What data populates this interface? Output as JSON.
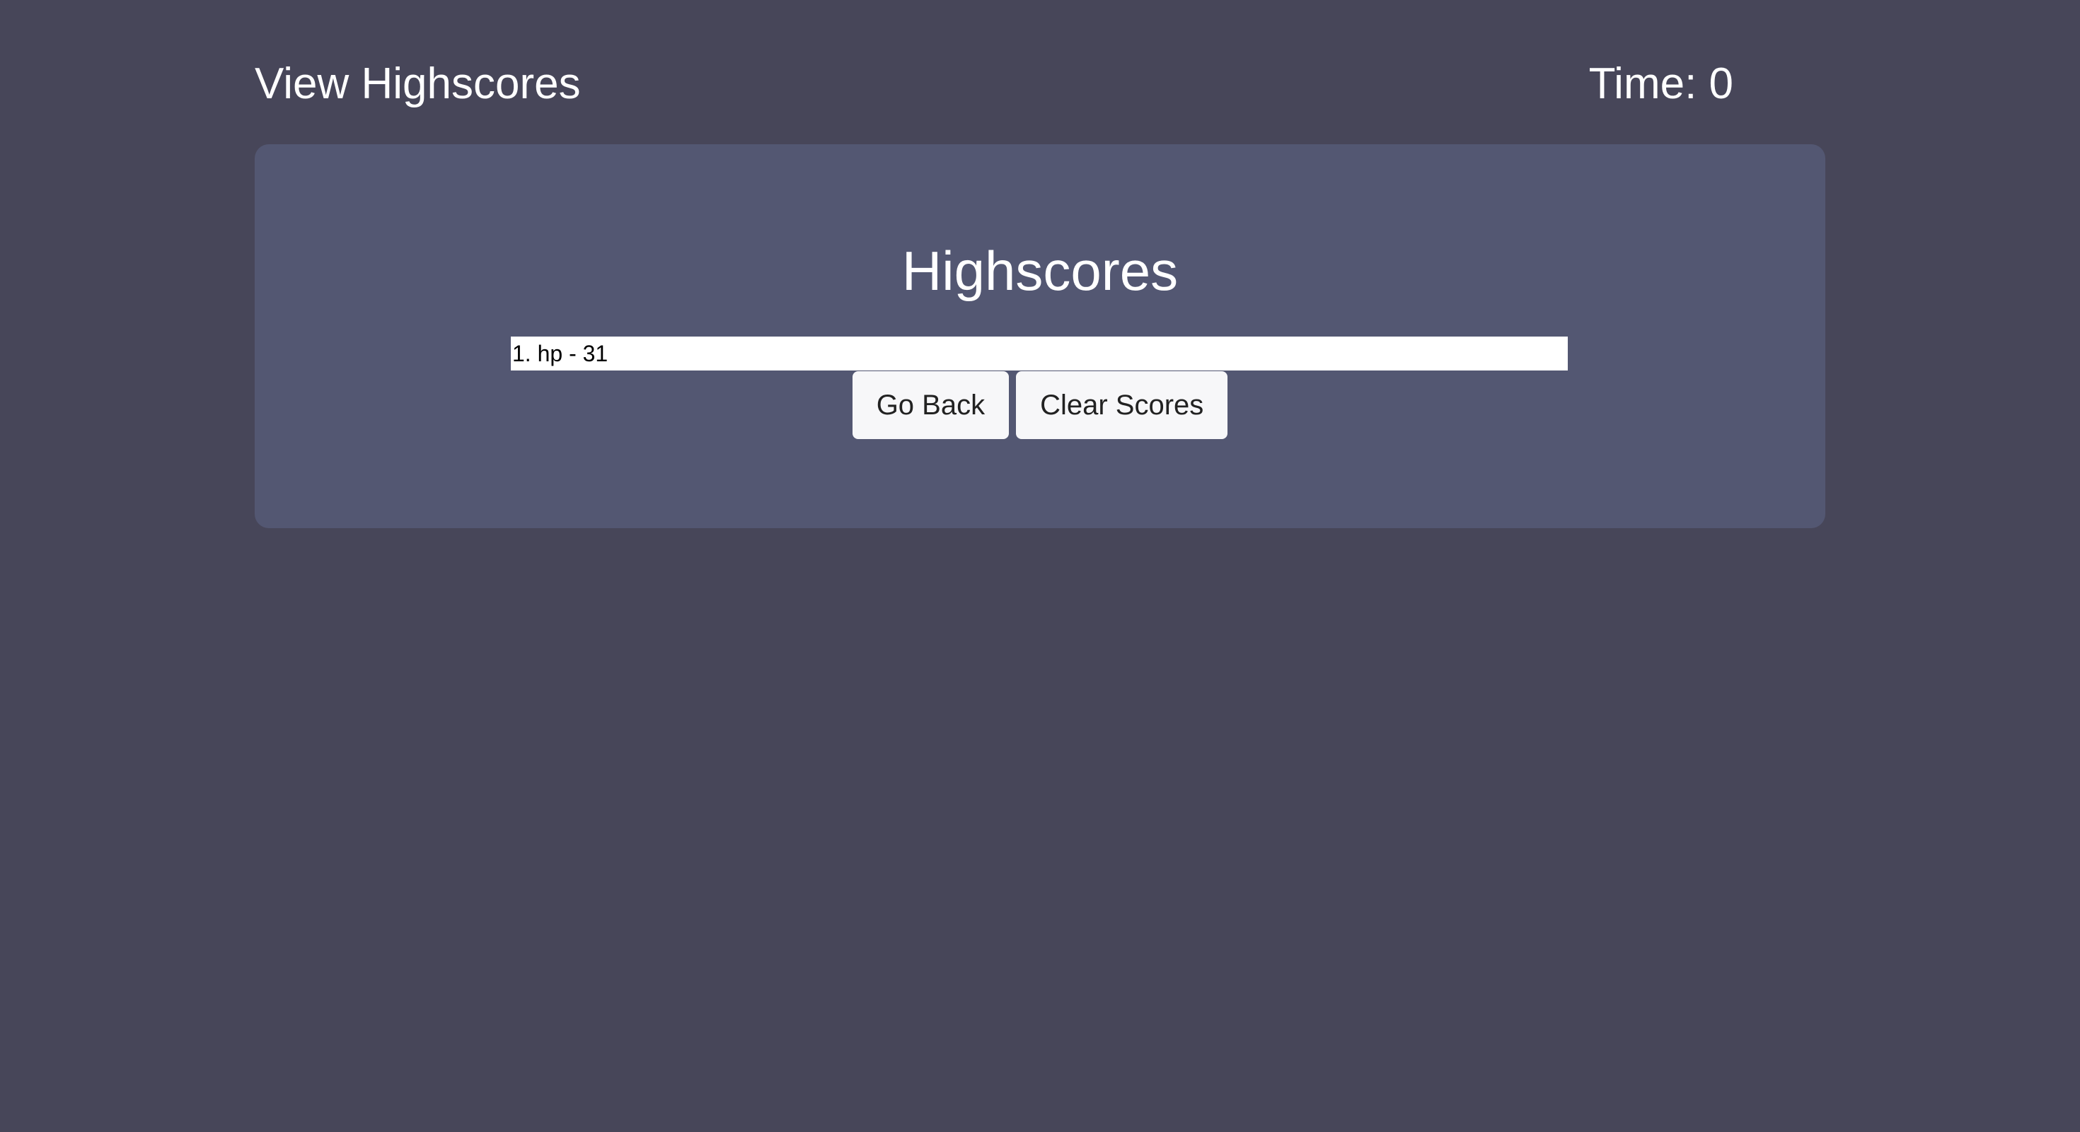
{
  "header": {
    "view_highscores_label": "View Highscores",
    "timer_label": "Time: 0"
  },
  "panel": {
    "title": "Highscores",
    "scores": [
      {
        "text": "1. hp - 31"
      }
    ],
    "buttons": {
      "go_back_label": "Go Back",
      "clear_scores_label": "Clear Scores"
    }
  },
  "colors": {
    "page_background": "#474659",
    "panel_background": "#535772",
    "text": "#ffffff",
    "button_background": "#f7f7f9"
  }
}
